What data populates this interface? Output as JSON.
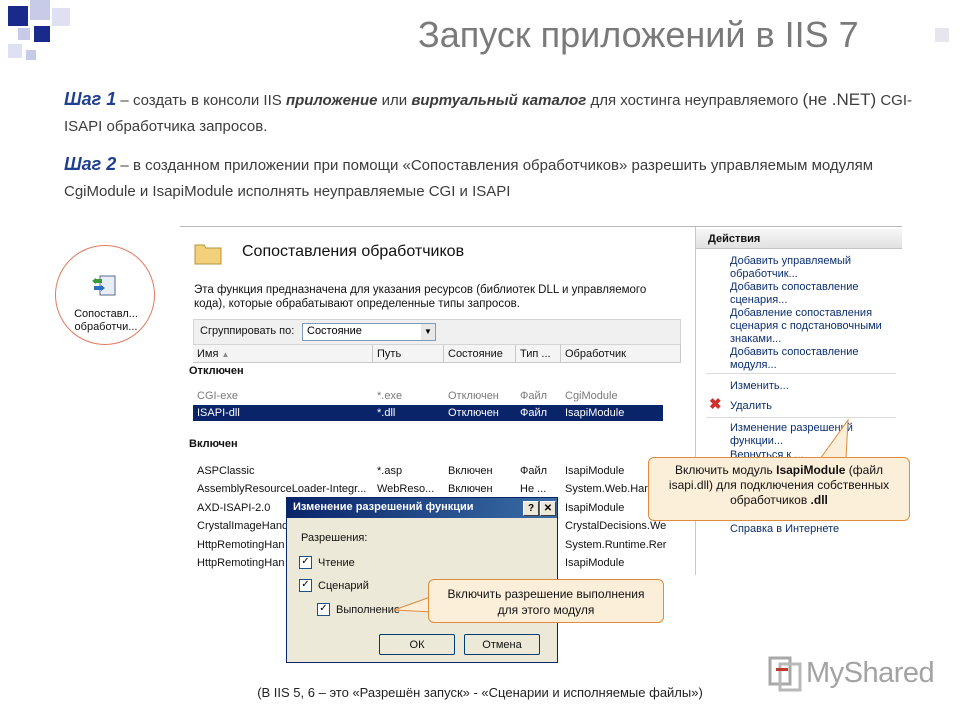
{
  "slide": {
    "title": "Запуск приложений в IIS 7",
    "step1": {
      "label": "Шаг 1",
      "t1": " – создать в консоли IIS ",
      "t2": "приложение",
      "t3": " или ",
      "t4": "виртуальный каталог",
      "t5": " для хостинга неуправляемого ",
      "t6": "(не .NET)",
      "t7": " CGI-ISAPI обработчика запросов."
    },
    "step2": {
      "label": "Шаг 2",
      "text": " – в созданном приложении при помощи «Сопоставления обработчиков» разрешить управляемым модулям CgiModule и IsapiModule исполнять неуправляемые CGI и ISAPI"
    },
    "footer": "(В IIS 5, 6 – это «Разрешён запуск» - «Сценарии и исполняемые файлы»)",
    "logo_text": "MyShared"
  },
  "icon_circle": {
    "label1": "Сопоставл...",
    "label2": "обработчи..."
  },
  "feature": {
    "heading": "Сопоставления обработчиков",
    "description": "Эта функция предназначена для указания ресурсов (библиотек DLL и управляемого кода), которые обрабатывают определенные типы запросов.",
    "group_label": "Сгруппировать по:",
    "group_value": "Состояние",
    "columns": [
      "Имя",
      "Путь",
      "Состояние",
      "Тип ...",
      "Обработчик"
    ],
    "groups": {
      "disabled": "Отключен",
      "enabled": "Включен"
    },
    "rows_disabled": [
      {
        "name": "CGI-exe",
        "path": "*.exe",
        "state": "Отключен",
        "type": "Файл",
        "handler": "CgiModule"
      },
      {
        "name": "ISAPI-dll",
        "path": "*.dll",
        "state": "Отключен",
        "type": "Файл",
        "handler": "IsapiModule"
      }
    ],
    "rows_enabled": [
      {
        "name": "ASPClassic",
        "path": "*.asp",
        "state": "Включен",
        "type": "Файл",
        "handler": "IsapiModule"
      },
      {
        "name": "AssemblyResourceLoader-Integr...",
        "path": "WebReso...",
        "state": "Включен",
        "type": "Не ...",
        "handler": "System.Web.Han"
      },
      {
        "name": "AXD-ISAPI-2.0",
        "path": "",
        "state": "",
        "type": "",
        "handler": "IsapiModule"
      },
      {
        "name": "CrystalImageHand",
        "path": "",
        "state": "",
        "type": "",
        "handler": "CrystalDecisions.We"
      },
      {
        "name": "HttpRemotingHan",
        "path": "",
        "state": "",
        "type": "",
        "handler": "System.Runtime.Rer"
      },
      {
        "name": "HttpRemotingHan",
        "path": "",
        "state": "",
        "type": "",
        "handler": "IsapiModule"
      }
    ]
  },
  "actions": {
    "header": "Действия",
    "add_managed": "Добавить управляемый обработчик...",
    "add_script": "Добавить сопоставление сценария...",
    "add_wildcard": "Добавление сопоставления сценария с подстановочными знаками...",
    "add_module": "Добавить сопоставление модуля...",
    "edit": "Изменить...",
    "delete": "Удалить",
    "edit_perms": "Изменение разрешений функции...",
    "revert": "Вернуться к ...",
    "help": "Справка в Интернете"
  },
  "callout_isapi": {
    "text1": "Включить модуль ",
    "bold": "IsapiModule",
    "text2": " (файл isapi.dll) для подключения собственных обработчиков ",
    "bold2": ".dll"
  },
  "callout_exec": "Включить разрешение выполнения для этого модуля",
  "dialog": {
    "title": "Изменение разрешений функции",
    "help_btn": "?",
    "close_btn": "✕",
    "perm_label": "Разрешения:",
    "read": "Чтение",
    "script": "Сценарий",
    "execute": "Выполнение",
    "ok": "ОК",
    "cancel": "Отмена"
  },
  "colors": {
    "accent_title": "#1f3f8f",
    "selection": "#0a246a",
    "callout_border": "#e08a3c",
    "callout_bg": "#fcefd9"
  }
}
